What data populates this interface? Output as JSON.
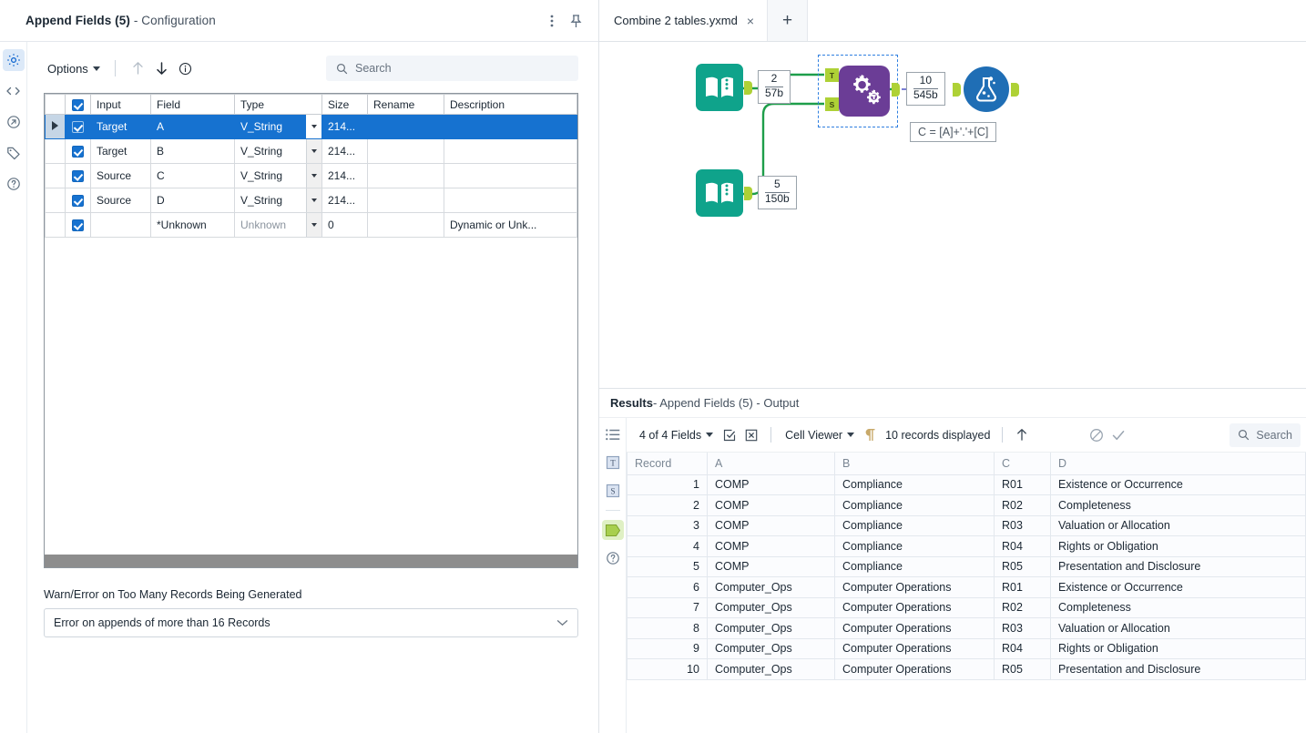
{
  "config": {
    "title_main": "Append Fields (5)",
    "title_sub": " - Configuration",
    "menu_icon": "kebab-menu-icon",
    "pin_icon": "pin-icon",
    "rail": [
      {
        "name": "gear-icon",
        "label": "Configuration",
        "active": true
      },
      {
        "name": "code-icon",
        "label": "Annotation"
      },
      {
        "name": "arrow-circle-icon",
        "label": "Output"
      },
      {
        "name": "tag-icon",
        "label": "Label"
      },
      {
        "name": "help-circle-icon",
        "label": "Help"
      }
    ],
    "toolbar": {
      "options_label": "Options",
      "up_label": "Move Up",
      "down_label": "Move Down",
      "info_label": "Info"
    },
    "search": {
      "placeholder": "Search",
      "value": ""
    },
    "table": {
      "headers": [
        "",
        "",
        "Input",
        "Field",
        "Type",
        "Size",
        "Rename",
        "Description"
      ],
      "header_checkbox_checked": true,
      "rows": [
        {
          "selected": true,
          "checked": true,
          "input": "Target",
          "field": "A",
          "type": "V_String",
          "type_muted": false,
          "size": "214...",
          "rename": "",
          "description": ""
        },
        {
          "selected": false,
          "checked": true,
          "input": "Target",
          "field": "B",
          "type": "V_String",
          "type_muted": false,
          "size": "214...",
          "rename": "",
          "description": ""
        },
        {
          "selected": false,
          "checked": true,
          "input": "Source",
          "field": "C",
          "type": "V_String",
          "type_muted": false,
          "size": "214...",
          "rename": "",
          "description": ""
        },
        {
          "selected": false,
          "checked": true,
          "input": "Source",
          "field": "D",
          "type": "V_String",
          "type_muted": false,
          "size": "214...",
          "rename": "",
          "description": ""
        },
        {
          "selected": false,
          "checked": true,
          "input": "",
          "field": "*Unknown",
          "type": "Unknown",
          "type_muted": true,
          "size": "0",
          "rename": "",
          "description": "Dynamic or Unk..."
        }
      ]
    },
    "warn": {
      "label": "Warn/Error on Too Many Records Being Generated",
      "value": "Error on appends of more than 16 Records"
    }
  },
  "tabs": {
    "items": [
      {
        "label": "Combine 2 tables.yxmd",
        "close": "×"
      }
    ],
    "add_label": "+"
  },
  "canvas": {
    "nodes": [
      {
        "name": "input-data-tool-1",
        "icon": "book-icon",
        "count": "2",
        "size": "57b"
      },
      {
        "name": "input-data-tool-2",
        "icon": "book-icon",
        "count": "5",
        "size": "150b"
      },
      {
        "name": "append-fields-tool",
        "icon": "gears-icon",
        "t_label": "T",
        "s_label": "S",
        "selected": true
      },
      {
        "name": "browse-tool",
        "icon": "flask-icon",
        "count": "10",
        "size": "545b"
      }
    ],
    "annotation": "C = [A]+'.'+[C]"
  },
  "results": {
    "title_main": "Results",
    "title_sub": " - Append Fields (5) - Output",
    "rail": [
      {
        "name": "list-icon",
        "active": false
      },
      {
        "name": "input-t-icon",
        "active": false
      },
      {
        "name": "input-s-icon",
        "active": false
      },
      {
        "name": "output-marker-icon",
        "active": true
      },
      {
        "name": "help-circle-icon",
        "active": false
      }
    ],
    "toolbar": {
      "fields_label": "4 of 4 Fields",
      "select_all_icon": "checkbox-check-icon",
      "deselect_all_icon": "checkbox-cross-icon",
      "cell_viewer_label": "Cell Viewer",
      "pilcrow_icon": "pilcrow-icon",
      "records_label": "10 records displayed",
      "up_icon": "arrow-up-icon",
      "block_icon": "no-entry-icon",
      "check_icon": "check-icon",
      "search_placeholder": "Search"
    },
    "grid": {
      "headers": [
        "Record",
        "A",
        "B",
        "C",
        "D"
      ],
      "rows": [
        {
          "record": "1",
          "a": "COMP",
          "b": "Compliance",
          "c": "R01",
          "d": "Existence or Occurrence"
        },
        {
          "record": "2",
          "a": "COMP",
          "b": "Compliance",
          "c": "R02",
          "d": "Completeness"
        },
        {
          "record": "3",
          "a": "COMP",
          "b": "Compliance",
          "c": "R03",
          "d": "Valuation or Allocation"
        },
        {
          "record": "4",
          "a": "COMP",
          "b": "Compliance",
          "c": "R04",
          "d": "Rights or Obligation"
        },
        {
          "record": "5",
          "a": "COMP",
          "b": "Compliance",
          "c": "R05",
          "d": "Presentation and Disclosure"
        },
        {
          "record": "6",
          "a": "Computer_Ops",
          "b": "Computer Operations",
          "c": "R01",
          "d": "Existence or Occurrence"
        },
        {
          "record": "7",
          "a": "Computer_Ops",
          "b": "Computer Operations",
          "c": "R02",
          "d": "Completeness"
        },
        {
          "record": "8",
          "a": "Computer_Ops",
          "b": "Computer Operations",
          "c": "R03",
          "d": "Valuation or Allocation"
        },
        {
          "record": "9",
          "a": "Computer_Ops",
          "b": "Computer Operations",
          "c": "R04",
          "d": "Rights or Obligation"
        },
        {
          "record": "10",
          "a": "Computer_Ops",
          "b": "Computer Operations",
          "c": "R05",
          "d": "Presentation and Disclosure"
        }
      ]
    }
  },
  "colors": {
    "selection_blue": "#1672d0",
    "append_purple": "#6b3d96",
    "input_teal": "#0fa38b",
    "browse_blue": "#1f6eb5",
    "connector_green": "#aed136",
    "wire_green": "#1e9e4a"
  }
}
